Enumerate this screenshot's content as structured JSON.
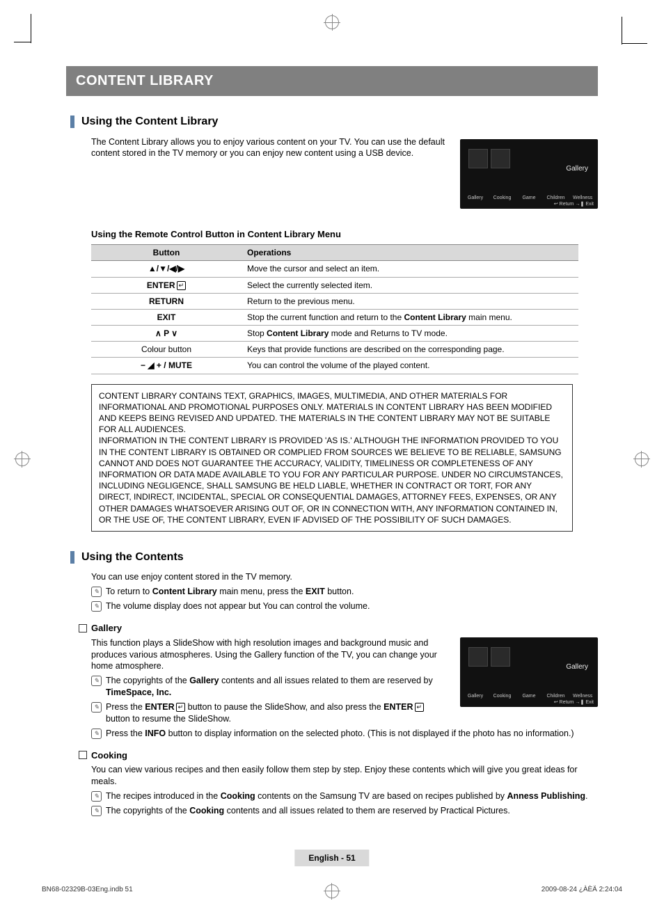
{
  "title_bar": "CONTENT LIBRARY",
  "section1": {
    "heading": "Using the Content Library",
    "intro": "The Content Library allows you to enjoy various content on your TV. You can use the default content stored in the TV memory or you can enjoy new content using a USB device."
  },
  "tv_preview": {
    "side_label": "Gallery",
    "icons": [
      "Gallery",
      "Cooking",
      "Game",
      "Children",
      "Wellness"
    ],
    "footer": "↩ Return   →❚ Exit"
  },
  "remote_subhead": "Using the Remote Control Button in Content Library Menu",
  "table": {
    "head_button": "Button",
    "head_ops": "Operations",
    "rows": [
      {
        "btn": "▲/▼/◀/▶",
        "op": "Move the cursor and select an item."
      },
      {
        "btn_html": "ENTER",
        "enter_glyph": true,
        "op": "Select the currently selected item."
      },
      {
        "btn": "RETURN",
        "op": "Return to the previous menu."
      },
      {
        "btn": "EXIT",
        "op_html": "Stop the current function and return to the <b>Content Library</b> main menu."
      },
      {
        "btn": "∧ P ∨",
        "op_html": "Stop <b>Content Library</b> mode and Returns to TV mode."
      },
      {
        "btn_plain": "Colour button",
        "op": "Keys that provide functions are described on the corresponding page."
      },
      {
        "btn_html": "− ◢ + / MUTE",
        "op": "You can control the volume of the played content."
      }
    ]
  },
  "disclaimer": "CONTENT LIBRARY CONTAINS TEXT, GRAPHICS, IMAGES, MULTIMEDIA, AND OTHER MATERIALS FOR INFORMATIONAL AND PROMOTIONAL PURPOSES ONLY. MATERIALS IN CONTENT LIBRARY HAS BEEN MODIFIED AND KEEPS BEING REVISED AND UPDATED. THE MATERIALS IN THE CONTENT LIBRARY MAY NOT BE SUITABLE FOR ALL AUDIENCES.\nINFORMATION IN THE CONTENT LIBRARY IS PROVIDED 'AS IS.' ALTHOUGH THE INFORMATION PROVIDED TO YOU IN THE CONTENT LIBRARY IS OBTAINED OR COMPLIED FROM SOURCES WE BELIEVE TO BE RELIABLE, SAMSUNG CANNOT AND DOES NOT GUARANTEE THE ACCURACY, VALIDITY, TIMELINESS OR COMPLETENESS OF ANY INFORMATION OR DATA MADE AVAILABLE TO YOU FOR ANY PARTICULAR PURPOSE. UNDER NO CIRCUMSTANCES, INCLUDING NEGLIGENCE, SHALL SAMSUNG BE HELD LIABLE, WHETHER IN CONTRACT OR TORT, FOR ANY DIRECT, INDIRECT, INCIDENTAL, SPECIAL OR CONSEQUENTIAL DAMAGES, ATTORNEY FEES, EXPENSES, OR ANY OTHER DAMAGES WHATSOEVER ARISING OUT OF, OR IN CONNECTION WITH, ANY INFORMATION CONTAINED IN, OR THE USE OF, THE CONTENT LIBRARY, EVEN IF ADVISED OF THE POSSIBILITY OF SUCH DAMAGES.",
  "section2": {
    "heading": "Using the Contents",
    "intro": "You can use enjoy content stored in the TV memory.",
    "note1_html": "To return to <b>Content Library</b> main menu, press the <b>EXIT</b> button.",
    "note2": "The volume display does not appear but You can control the volume."
  },
  "gallery": {
    "heading": "Gallery",
    "body": "This function plays a SlideShow with high resolution images and background music and produces various atmospheres. Using the Gallery function of the TV, you can change your home atmosphere.",
    "note1_html": "The copyrights of the <b>Gallery</b> contents and all issues related to them are reserved by <b>TimeSpace, Inc.</b>",
    "note2_html": "Press the <b>ENTER</b><span class=\"enter-glyph\">↵</span> button to pause the SlideShow, and also press the <b>ENTER</b><span class=\"enter-glyph\">↵</span> button to resume the SlideShow.",
    "note3_html": "Press the <b>INFO</b> button to display information on the selected photo. (This is not displayed if the photo has no information.)"
  },
  "cooking": {
    "heading": "Cooking",
    "body": "You can view various recipes and then easily follow them step by step. Enjoy these contents which will give you great ideas for meals.",
    "note1_html": "The recipes introduced in the <b>Cooking</b> contents on the Samsung TV are based on recipes published by <b>Anness Publishing</b>.",
    "note2_html": "The copyrights of the <b>Cooking</b> contents and all issues related to them are reserved by Practical Pictures."
  },
  "footer": {
    "page": "English - 51",
    "print_left": "BN68-02329B-03Eng.indb   51",
    "print_right": "2009-08-24   ¿ÀÈÄ 2:24:04"
  }
}
